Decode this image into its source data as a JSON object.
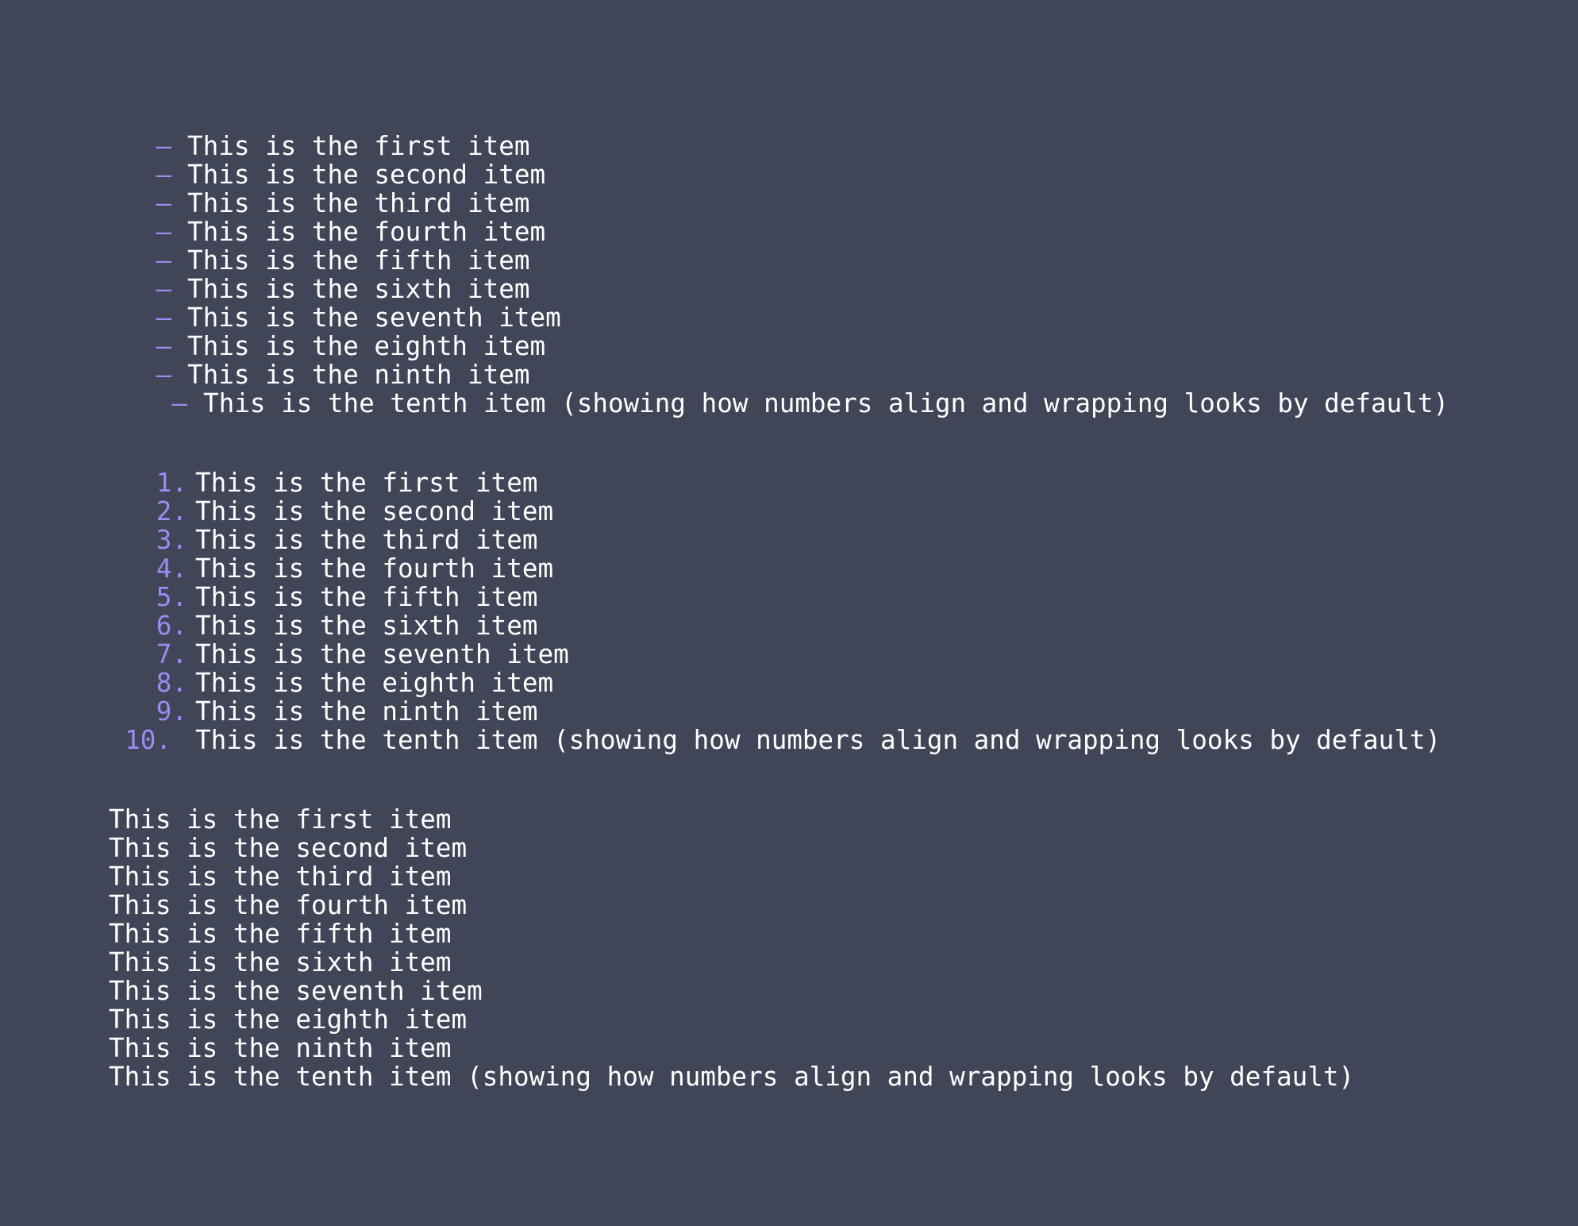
{
  "background_color": "#414558",
  "marker_color": "#9a8cf2",
  "text_color": "#ffffff",
  "bullet_list": {
    "marker": "—",
    "items": [
      "This is the first item",
      "This is the second item",
      "This is the third item",
      "This is the fourth item",
      "This is the fifth item",
      "This is the sixth item",
      "This is the seventh item",
      "This is the eighth item",
      "This is the ninth item",
      "This is the tenth item (showing how numbers align and wrapping looks by default)"
    ]
  },
  "numbered_list": {
    "markers": [
      "1.",
      "2.",
      "3.",
      "4.",
      "5.",
      "6.",
      "7.",
      "8.",
      "9.",
      "10."
    ],
    "items": [
      "This is the first item",
      "This is the second item",
      "This is the third item",
      "This is the fourth item",
      "This is the fifth item",
      "This is the sixth item",
      "This is the seventh item",
      "This is the eighth item",
      "This is the ninth item",
      "This is the tenth item (showing how numbers align and wrapping looks by default)"
    ]
  },
  "plain_list": {
    "items": [
      "This is the first item",
      "This is the second item",
      "This is the third item",
      "This is the fourth item",
      "This is the fifth item",
      "This is the sixth item",
      "This is the seventh item",
      "This is the eighth item",
      "This is the ninth item",
      "This is the tenth item (showing how numbers align and wrapping looks by default)"
    ]
  }
}
